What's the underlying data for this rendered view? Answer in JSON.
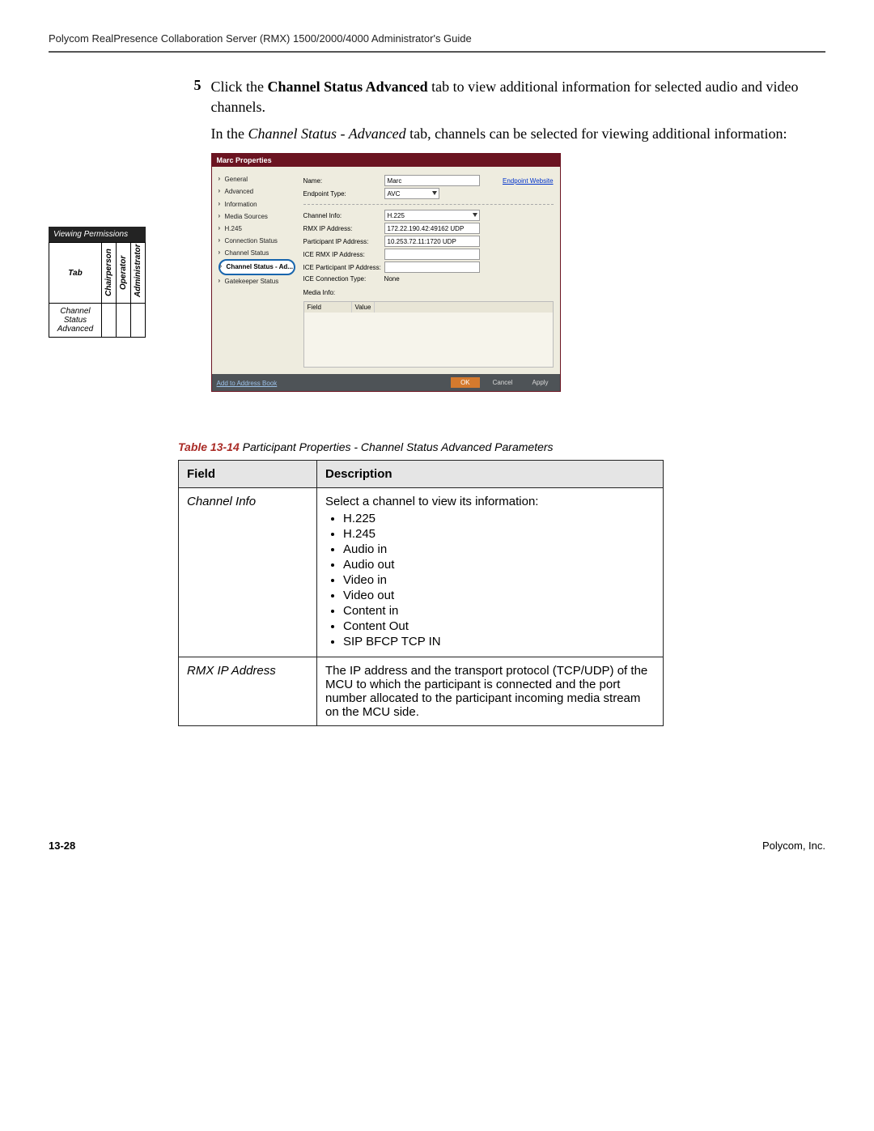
{
  "header": {
    "running_head": "Polycom RealPresence Collaboration Server (RMX) 1500/2000/4000 Administrator's Guide"
  },
  "step": {
    "number": "5",
    "p1_a": "Click the ",
    "p1_b": "Channel Status Advanced",
    "p1_c": " tab to view additional information for selected audio and video channels.",
    "p2_a": "In the ",
    "p2_b": "Channel Status - Advanced",
    "p2_c": " tab, channels can be selected for viewing additional information:"
  },
  "permissions": {
    "title": "Viewing Permissions",
    "tab_label": "Tab",
    "cols": [
      "Chairperson",
      "Operator",
      "Administrator"
    ],
    "row_label": "Channel Status Advanced"
  },
  "dialog": {
    "title": "Marc Properties",
    "sidebar": [
      "General",
      "Advanced",
      "Information",
      "Media Sources",
      "H.245",
      "Connection Status",
      "Channel Status",
      "Channel Status - Ad...",
      "Gatekeeper Status"
    ],
    "name_label": "Name:",
    "name_value": "Marc",
    "endpoint_website": "Endpoint Website",
    "endpoint_type_label": "Endpoint Type:",
    "endpoint_type_value": "AVC",
    "channel_info_label": "Channel Info:",
    "channel_info_value": "H.225",
    "rmx_ip_label": "RMX IP Address:",
    "rmx_ip_value": "172.22.190.42:49162 UDP",
    "participant_ip_label": "Participant IP Address:",
    "participant_ip_value": "10.253.72.11:1720 UDP",
    "ice_rmx_label": "ICE RMX IP Address:",
    "ice_participant_label": "ICE Participant IP Address:",
    "ice_conn_type_label": "ICE Connection Type:",
    "ice_conn_type_value": "None",
    "media_info_label": "Media Info:",
    "mi_field": "Field",
    "mi_value": "Value",
    "add_to_book": "Add to Address Book",
    "ok": "OK",
    "cancel": "Cancel",
    "apply": "Apply"
  },
  "table_caption": {
    "strong": "Table 13-14",
    "rest": " Participant Properties - Channel Status Advanced Parameters"
  },
  "bigtable": {
    "head_field": "Field",
    "head_desc": "Description",
    "r1_field": "Channel Info",
    "r1_intro": "Select a channel to view its information:",
    "r1_items": [
      "H.225",
      "H.245",
      "Audio in",
      "Audio out",
      "Video in",
      "Video out",
      "Content in",
      "Content Out",
      "SIP BFCP TCP IN"
    ],
    "r2_field": "RMX IP Address",
    "r2_desc": "The IP address and the transport protocol (TCP/UDP) of the MCU to which the participant is connected and the port number allocated to the participant incoming media stream on the MCU side."
  },
  "footer": {
    "left": "13-28",
    "right": "Polycom, Inc."
  }
}
